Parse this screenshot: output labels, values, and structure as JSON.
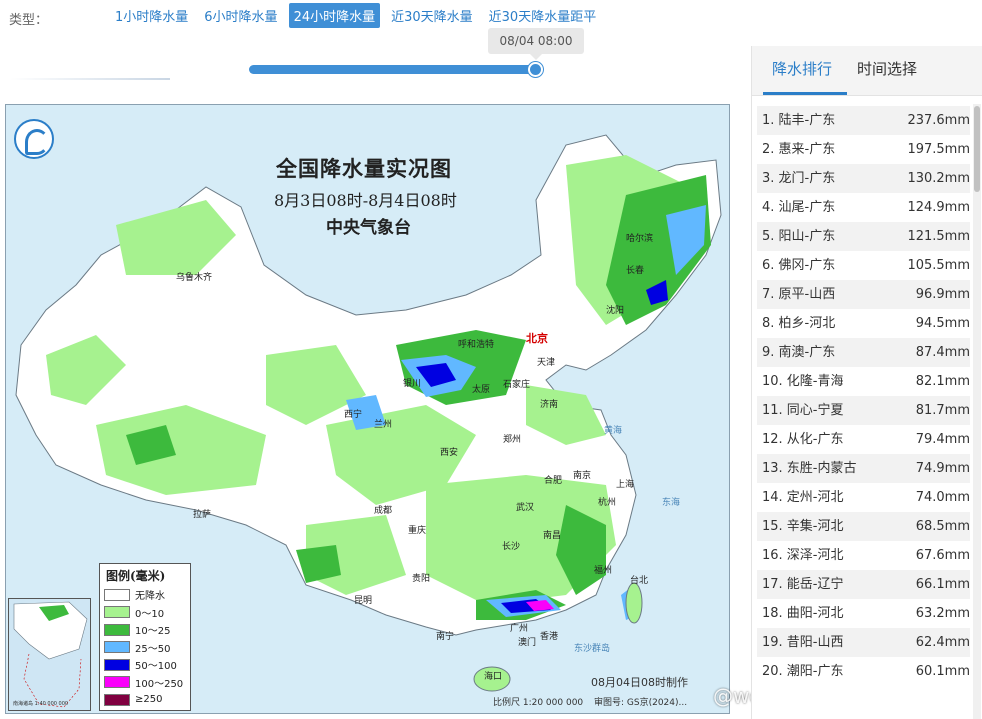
{
  "type_bar": {
    "label": "类型：",
    "tabs": [
      {
        "label": "1小时降水量",
        "active": false
      },
      {
        "label": "6小时降水量",
        "active": false
      },
      {
        "label": "24小时降水量",
        "active": true
      },
      {
        "label": "近30天降水量",
        "active": false
      },
      {
        "label": "近30天降水量距平",
        "active": false
      }
    ]
  },
  "time_slider": {
    "current_time": "08/04 08:00",
    "position_percent": 100
  },
  "map": {
    "title": "全国降水量实况图",
    "subtitle": "8月3日08时-8月4日08时",
    "organization": "中央气象台",
    "capital": "北京",
    "cities": [
      "乌鲁木齐",
      "拉萨",
      "西宁",
      "兰州",
      "银川",
      "呼和浩特",
      "太原",
      "石家庄",
      "天津",
      "济南",
      "郑州",
      "西安",
      "成都",
      "重庆",
      "贵阳",
      "昆明",
      "南宁",
      "广州",
      "澳门",
      "香港",
      "海口",
      "长沙",
      "南昌",
      "武汉",
      "合肥",
      "南京",
      "上海",
      "杭州",
      "福州",
      "台北",
      "沈阳",
      "长春",
      "哈尔滨"
    ],
    "seas": [
      "黄海",
      "东海",
      "东沙群岛"
    ],
    "legend": {
      "title": "图例(毫米)",
      "items": [
        {
          "label": "无降水",
          "color": "#ffffff"
        },
        {
          "label": "0～10",
          "color": "#a6f28f"
        },
        {
          "label": "10～25",
          "color": "#3dba3d"
        },
        {
          "label": "25～50",
          "color": "#61b8ff"
        },
        {
          "label": "50～100",
          "color": "#0000e1"
        },
        {
          "label": "100～250",
          "color": "#fa00fa"
        },
        {
          "label": "≥250",
          "color": "#800040"
        }
      ]
    },
    "inset_caption": "南海诸岛 1:40 000 000",
    "scale": "比例尺 1:20 000 000",
    "made": "08月04日08时制作",
    "review": "审图号: GS京(2024)...",
    "watermark": "@weatherman_信欣"
  },
  "ranking": {
    "tabs": [
      {
        "label": "降水排行",
        "active": true
      },
      {
        "label": "时间选择",
        "active": false
      }
    ],
    "unit": "mm",
    "rows": [
      {
        "rank": 1,
        "name": "陆丰-广东",
        "value": 237.6
      },
      {
        "rank": 2,
        "name": "惠来-广东",
        "value": 197.5
      },
      {
        "rank": 3,
        "name": "龙门-广东",
        "value": 130.2
      },
      {
        "rank": 4,
        "name": "汕尾-广东",
        "value": 124.9
      },
      {
        "rank": 5,
        "name": "阳山-广东",
        "value": 121.5
      },
      {
        "rank": 6,
        "name": "佛冈-广东",
        "value": 105.5
      },
      {
        "rank": 7,
        "name": "原平-山西",
        "value": 96.9
      },
      {
        "rank": 8,
        "name": "柏乡-河北",
        "value": 94.5
      },
      {
        "rank": 9,
        "name": "南澳-广东",
        "value": 87.4
      },
      {
        "rank": 10,
        "name": "化隆-青海",
        "value": 82.1
      },
      {
        "rank": 11,
        "name": "同心-宁夏",
        "value": 81.7
      },
      {
        "rank": 12,
        "name": "从化-广东",
        "value": 79.4
      },
      {
        "rank": 13,
        "name": "东胜-内蒙古",
        "value": 74.9
      },
      {
        "rank": 14,
        "name": "定州-河北",
        "value": 74.0
      },
      {
        "rank": 15,
        "name": "辛集-河北",
        "value": 68.5
      },
      {
        "rank": 16,
        "name": "深泽-河北",
        "value": 67.6
      },
      {
        "rank": 17,
        "name": "能岳-辽宁",
        "value": 66.1
      },
      {
        "rank": 18,
        "name": "曲阳-河北",
        "value": 63.2
      },
      {
        "rank": 19,
        "name": "昔阳-山西",
        "value": 62.4
      },
      {
        "rank": 20,
        "name": "潮阳-广东",
        "value": 60.1
      }
    ]
  }
}
